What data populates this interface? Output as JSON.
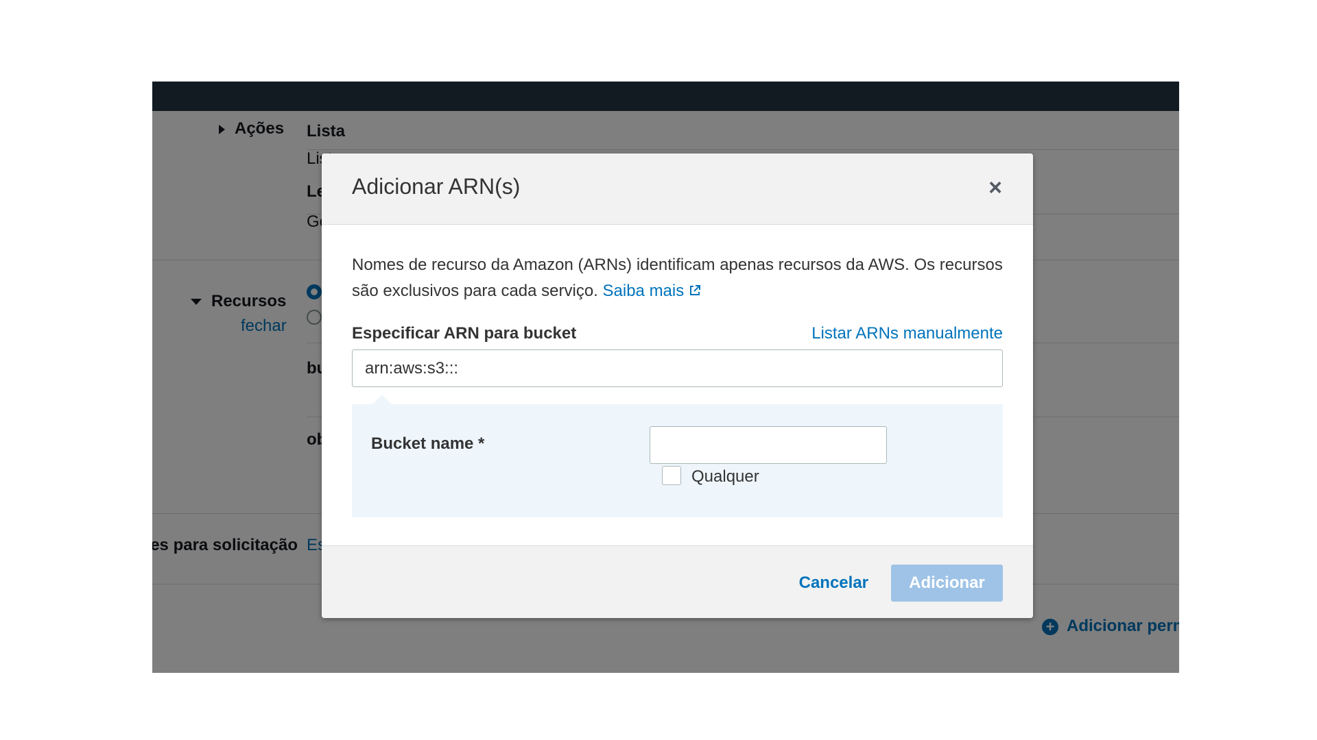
{
  "background": {
    "actions_label": "Ações",
    "list_heading": "Lista",
    "list_item": "List",
    "read_heading": "Leitura",
    "read_item": "Get",
    "resources_label": "Recursos",
    "close_link": "fechar",
    "resource_bucket": "bucket",
    "resource_object": "object",
    "request_conditions_label": "Condições para solicitação",
    "request_conditions_link": "Especificar",
    "add_permissions": "Adicionar permissões"
  },
  "modal": {
    "title": "Adicionar ARN(s)",
    "close_icon": "close-icon",
    "description": "Nomes de recurso da Amazon (ARNs) identificam apenas recursos da AWS. Os recursos são exclusivos para cada serviço.",
    "learn_more": "Saiba mais",
    "field_label": "Especificar ARN para bucket",
    "list_manually": "Listar ARNs manualmente",
    "arn_value": "arn:aws:s3:::",
    "bucket_name_label": "Bucket name *",
    "bucket_name_value": "",
    "any_label": "Qualquer",
    "cancel": "Cancelar",
    "add": "Adicionar"
  },
  "colors": {
    "topbar": "#121a22",
    "link": "#0073bb",
    "primary_disabled": "#9ec3e6",
    "builder_bg": "#eef6fc"
  }
}
